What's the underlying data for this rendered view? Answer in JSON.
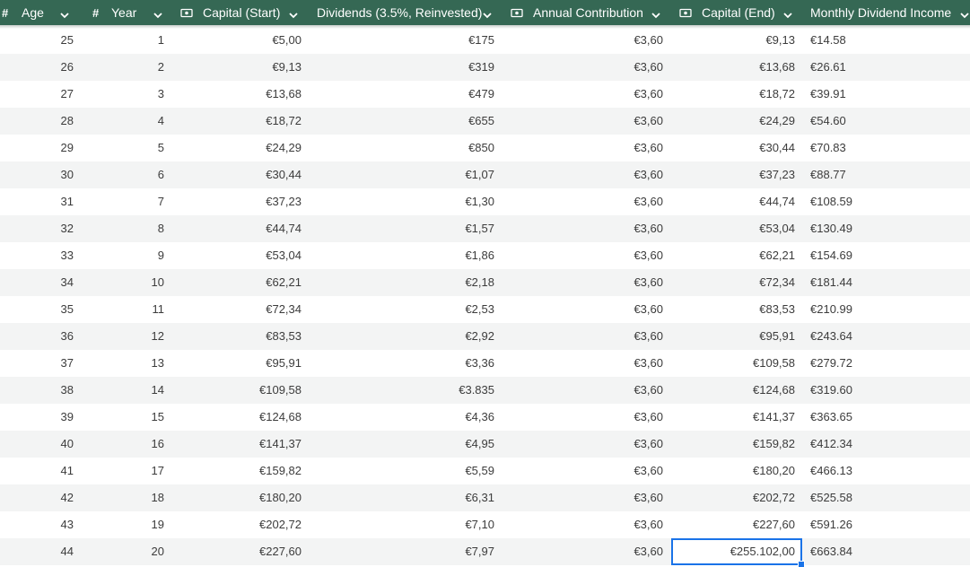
{
  "columns": [
    {
      "label": "Age",
      "icon": "number-icon"
    },
    {
      "label": "Year",
      "icon": "number-icon"
    },
    {
      "label": "Capital (Start)",
      "icon": "currency-icon"
    },
    {
      "label": "Dividends (3.5%, Reinvested)",
      "icon": ""
    },
    {
      "label": "Annual Contribution",
      "icon": "currency-icon"
    },
    {
      "label": "Capital (End)",
      "icon": "currency-icon"
    },
    {
      "label": "Monthly Dividend Income",
      "icon": ""
    }
  ],
  "rows": [
    [
      "25",
      "1",
      "€5,00",
      "€175",
      "€3,60",
      "€9,13",
      "€14.58"
    ],
    [
      "26",
      "2",
      "€9,13",
      "€319",
      "€3,60",
      "€13,68",
      "€26.61"
    ],
    [
      "27",
      "3",
      "€13,68",
      "€479",
      "€3,60",
      "€18,72",
      "€39.91"
    ],
    [
      "28",
      "4",
      "€18,72",
      "€655",
      "€3,60",
      "€24,29",
      "€54.60"
    ],
    [
      "29",
      "5",
      "€24,29",
      "€850",
      "€3,60",
      "€30,44",
      "€70.83"
    ],
    [
      "30",
      "6",
      "€30,44",
      "€1,07",
      "€3,60",
      "€37,23",
      "€88.77"
    ],
    [
      "31",
      "7",
      "€37,23",
      "€1,30",
      "€3,60",
      "€44,74",
      "€108.59"
    ],
    [
      "32",
      "8",
      "€44,74",
      "€1,57",
      "€3,60",
      "€53,04",
      "€130.49"
    ],
    [
      "33",
      "9",
      "€53,04",
      "€1,86",
      "€3,60",
      "€62,21",
      "€154.69"
    ],
    [
      "34",
      "10",
      "€62,21",
      "€2,18",
      "€3,60",
      "€72,34",
      "€181.44"
    ],
    [
      "35",
      "11",
      "€72,34",
      "€2,53",
      "€3,60",
      "€83,53",
      "€210.99"
    ],
    [
      "36",
      "12",
      "€83,53",
      "€2,92",
      "€3,60",
      "€95,91",
      "€243.64"
    ],
    [
      "37",
      "13",
      "€95,91",
      "€3,36",
      "€3,60",
      "€109,58",
      "€279.72"
    ],
    [
      "38",
      "14",
      "€109,58",
      "€3.835",
      "€3,60",
      "€124,68",
      "€319.60"
    ],
    [
      "39",
      "15",
      "€124,68",
      "€4,36",
      "€3,60",
      "€141,37",
      "€363.65"
    ],
    [
      "40",
      "16",
      "€141,37",
      "€4,95",
      "€3,60",
      "€159,82",
      "€412.34"
    ],
    [
      "41",
      "17",
      "€159,82",
      "€5,59",
      "€3,60",
      "€180,20",
      "€466.13"
    ],
    [
      "42",
      "18",
      "€180,20",
      "€6,31",
      "€3,60",
      "€202,72",
      "€525.58"
    ],
    [
      "43",
      "19",
      "€202,72",
      "€7,10",
      "€3,60",
      "€227,60",
      "€591.26"
    ],
    [
      "44",
      "20",
      "€227,60",
      "€7,97",
      "€3,60",
      "€255.102,00",
      "€663.84"
    ]
  ],
  "selected_cell": {
    "row": 19,
    "col": 5
  },
  "colors": {
    "header_bg": "#356854",
    "header_text": "#ffffff",
    "row_alt": "#f3f4f4",
    "selection": "#1a73e8"
  }
}
